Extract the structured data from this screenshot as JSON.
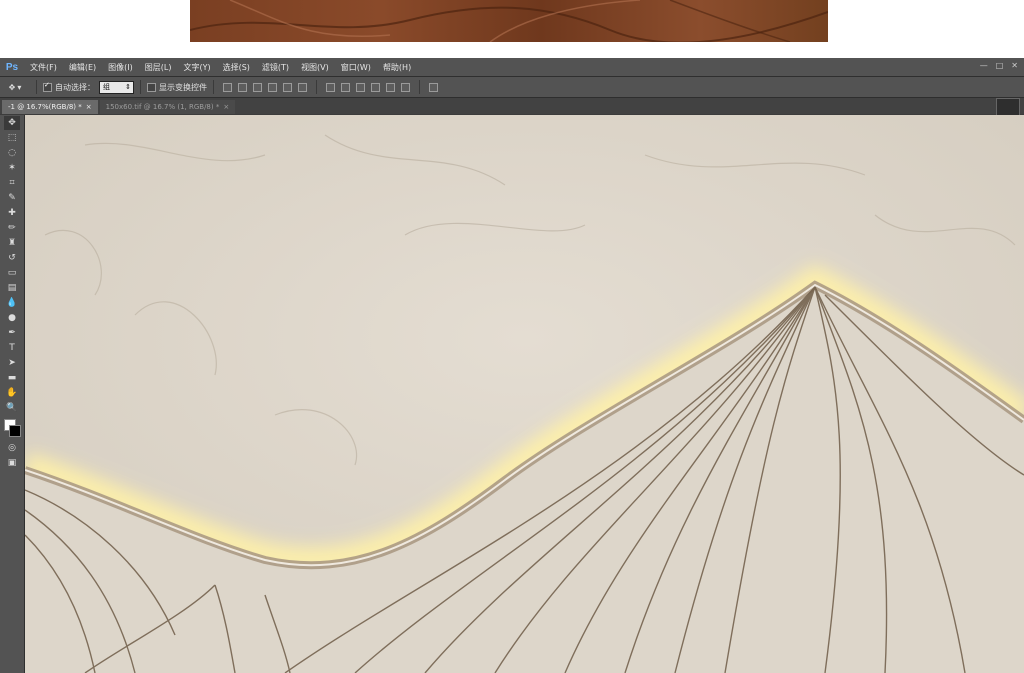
{
  "app": {
    "logo": "Ps"
  },
  "menu": [
    "文件(F)",
    "编辑(E)",
    "图像(I)",
    "图层(L)",
    "文字(Y)",
    "选择(S)",
    "滤镜(T)",
    "视图(V)",
    "窗口(W)",
    "帮助(H)"
  ],
  "window_controls": [
    "—",
    "□",
    "✕"
  ],
  "options": {
    "auto_select_label": "自动选择：",
    "auto_select_checked": true,
    "auto_select_value": "组",
    "show_transform_label": "显示变换控件",
    "show_transform_checked": false
  },
  "tabs": [
    {
      "label": "-1 @ 16.7%(RGB/8) *",
      "active": true
    },
    {
      "label": "150x60.tif @ 16.7% (1, RGB/8) *",
      "active": false
    }
  ],
  "tab_close_glyph": "×",
  "tools": [
    "move-icon",
    "marquee-icon",
    "lasso-icon",
    "magic-wand-icon",
    "crop-icon",
    "eyedropper-icon",
    "healing-icon",
    "brush-icon",
    "stamp-icon",
    "history-brush-icon",
    "eraser-icon",
    "gradient-icon",
    "blur-icon",
    "dodge-icon",
    "pen-icon",
    "type-icon",
    "path-select-icon",
    "rectangle-icon",
    "hand-icon",
    "zoom-icon"
  ],
  "tool_glyphs": [
    "✥",
    "⬚",
    "◌",
    "✶",
    "⌗",
    "✎",
    "✚",
    "✏",
    "♜",
    "↺",
    "▭",
    "▤",
    "💧",
    "●",
    "✒",
    "T",
    "➤",
    "▬",
    "✋",
    "🔍"
  ],
  "colors": {
    "foreground": "#ffffff",
    "background": "#000000",
    "canvas": "#ddd6cb",
    "glow": "#fff3b0",
    "line": "#8a7358"
  }
}
